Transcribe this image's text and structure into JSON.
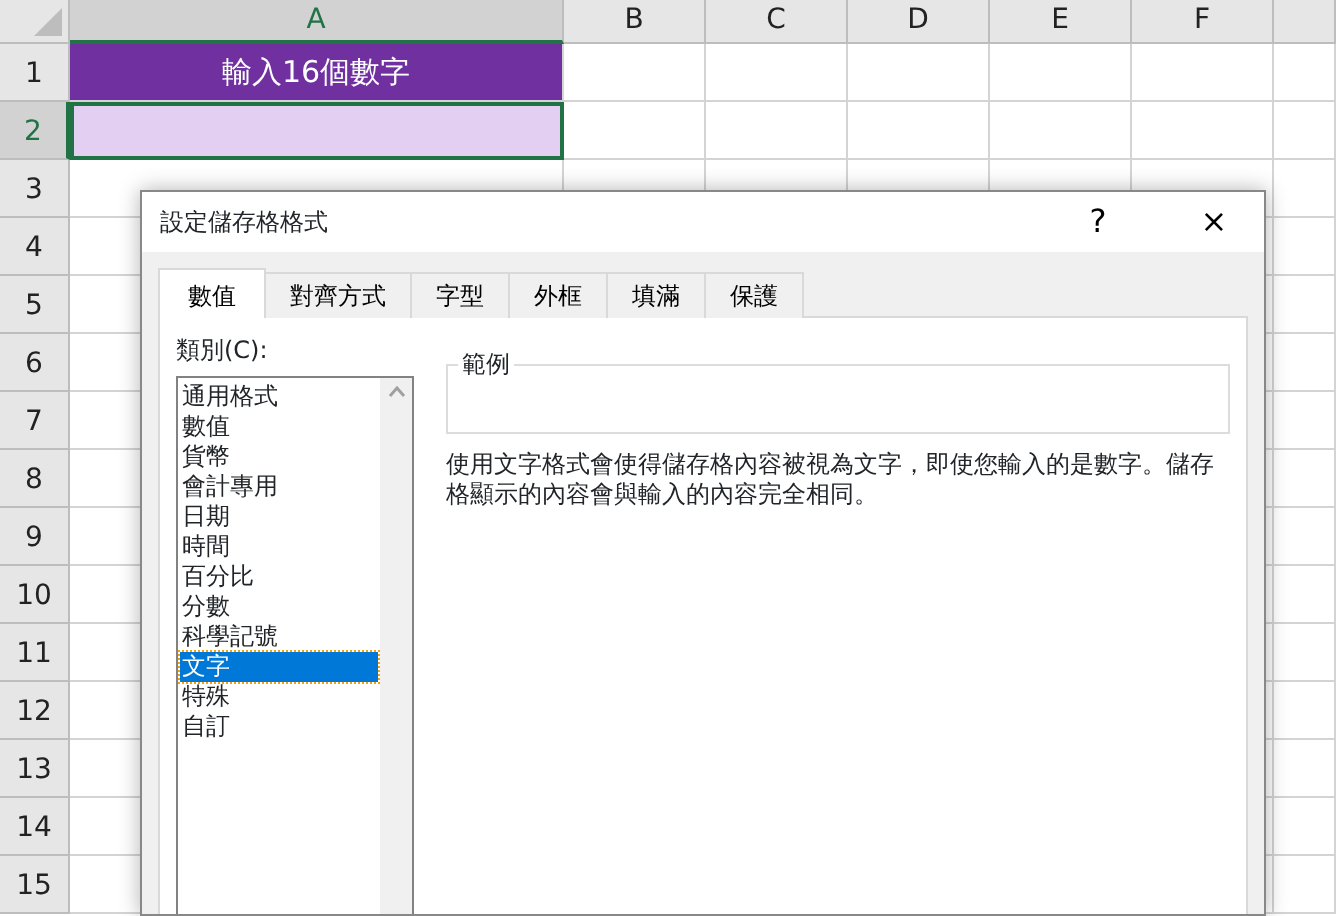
{
  "sheet": {
    "columns": [
      {
        "label": "A",
        "selected": true
      },
      {
        "label": "B",
        "selected": false
      },
      {
        "label": "C",
        "selected": false
      },
      {
        "label": "D",
        "selected": false
      },
      {
        "label": "E",
        "selected": false
      },
      {
        "label": "F",
        "selected": false
      }
    ],
    "rows": [
      {
        "label": "1",
        "selected": false
      },
      {
        "label": "2",
        "selected": true
      },
      {
        "label": "3",
        "selected": false
      },
      {
        "label": "4",
        "selected": false
      },
      {
        "label": "5",
        "selected": false
      },
      {
        "label": "6",
        "selected": false
      },
      {
        "label": "7",
        "selected": false
      },
      {
        "label": "8",
        "selected": false
      },
      {
        "label": "9",
        "selected": false
      },
      {
        "label": "10",
        "selected": false
      },
      {
        "label": "11",
        "selected": false
      },
      {
        "label": "12",
        "selected": false
      },
      {
        "label": "13",
        "selected": false
      },
      {
        "label": "14",
        "selected": false
      },
      {
        "label": "15",
        "selected": false
      }
    ],
    "column_a_cells": [
      {
        "kind": "title",
        "text": "輸入16個數字",
        "selected": false
      },
      {
        "kind": "input",
        "selected": true
      }
    ]
  },
  "dialog": {
    "title": "設定儲存格格式",
    "help": "?",
    "close": "×",
    "tabs": [
      {
        "label": "數值",
        "selected": true
      },
      {
        "label": "對齊方式",
        "selected": false
      },
      {
        "label": "字型",
        "selected": false
      },
      {
        "label": "外框",
        "selected": false
      },
      {
        "label": "填滿",
        "selected": false
      },
      {
        "label": "保護",
        "selected": false
      }
    ],
    "category_label": "類別(C):",
    "categories": [
      {
        "label": "通用格式",
        "selected": false
      },
      {
        "label": "數值",
        "selected": false
      },
      {
        "label": "貨幣",
        "selected": false
      },
      {
        "label": "會計專用",
        "selected": false
      },
      {
        "label": "日期",
        "selected": false
      },
      {
        "label": "時間",
        "selected": false
      },
      {
        "label": "百分比",
        "selected": false
      },
      {
        "label": "分數",
        "selected": false
      },
      {
        "label": "科學記號",
        "selected": false
      },
      {
        "label": "文字",
        "selected": true
      },
      {
        "label": "特殊",
        "selected": false
      },
      {
        "label": "自訂",
        "selected": false
      }
    ],
    "sample_label": "範例",
    "description": "使用文字格式會使得儲存格內容被視為文字，即使您輸入的是數字。儲存格顯示的內容會與輸入的內容完全相同。"
  }
}
